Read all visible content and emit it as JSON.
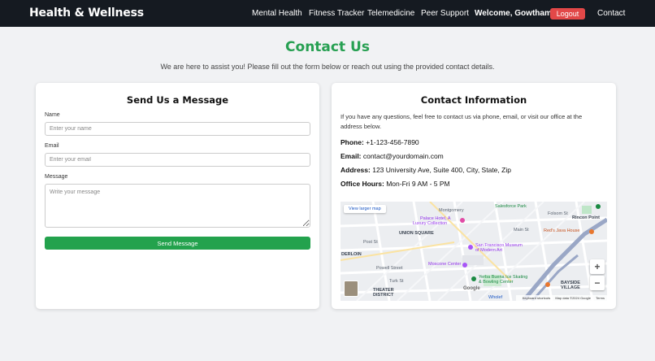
{
  "navbar": {
    "brand": "Health & Wellness",
    "links": {
      "mental_health": "Mental Health",
      "fitness_tracker": "Fitness Tracker",
      "telemedicine": "Telemedicine",
      "peer_support": "Peer Support",
      "contact": "Contact"
    },
    "welcome": "Welcome, Gowtham",
    "logout_label": "Logout"
  },
  "page": {
    "title": "Contact Us",
    "subtitle": "We are here to assist you! Please fill out the form below or reach out using the provided contact details."
  },
  "form": {
    "title": "Send Us a Message",
    "name_label": "Name",
    "name_placeholder": "Enter your name",
    "name_value": "",
    "email_label": "Email",
    "email_placeholder": "Enter your email",
    "email_value": "",
    "message_label": "Message",
    "message_placeholder": "Write your message",
    "message_value": "",
    "submit_label": "Send Message"
  },
  "contact_info": {
    "title": "Contact Information",
    "intro": "If you have any questions, feel free to contact us via phone, email, or visit our office at the address below.",
    "phone_label": "Phone:",
    "phone": "+1-123-456-7890",
    "email_label": "Email:",
    "email": "contact@yourdomain.com",
    "address_label": "Address:",
    "address": "123 University Ave, Suite 400, City, State, Zip",
    "hours_label": "Office Hours:",
    "hours": "Mon-Fri 9 AM - 5 PM"
  },
  "map": {
    "larger_map_link": "View larger map",
    "zoom_in": "+",
    "zoom_out": "−",
    "google": "Google",
    "keyboard_shortcuts": "Keyboard shortcuts",
    "map_data": "Map data ©2024 Google",
    "terms": "Terms",
    "labels": {
      "salesforce_park": "Salesforce Park",
      "montgomery": "Montgomery",
      "palace_hotel": "Palace Hotel, A",
      "luxury_collection": "Luxury Collection",
      "rincon_point": "Rincon Point",
      "union_square": "UNION SQUARE",
      "reds_java_house": "Red's Java House",
      "sfmoma_1": "San Francisco Museum",
      "sfmoma_2": "of Modern Art",
      "derloin": "DERLOIN",
      "powell_street": "Powell Street",
      "moscone_center": "Moscone Center",
      "yerba_buena_1": "Yerba Buena Ice Skating",
      "yerba_buena_2": "& Bowling Center",
      "theater_district_1": "THEATER",
      "theater_district_2": "DISTRICT",
      "bayside_village_1": "BAYSIDE",
      "bayside_village_2": "VILLAGE",
      "turk_st": "Turk St",
      "post_st": "Post St",
      "wholefoods": "Wholef",
      "folsom_st": "Folsom St",
      "main_st": "Main St"
    }
  },
  "colors": {
    "navbar_bg": "#151a21",
    "accent_green": "#27a052",
    "logout_red": "#e24848",
    "button_green": "#23a24d",
    "page_bg": "#f1f2f4"
  }
}
